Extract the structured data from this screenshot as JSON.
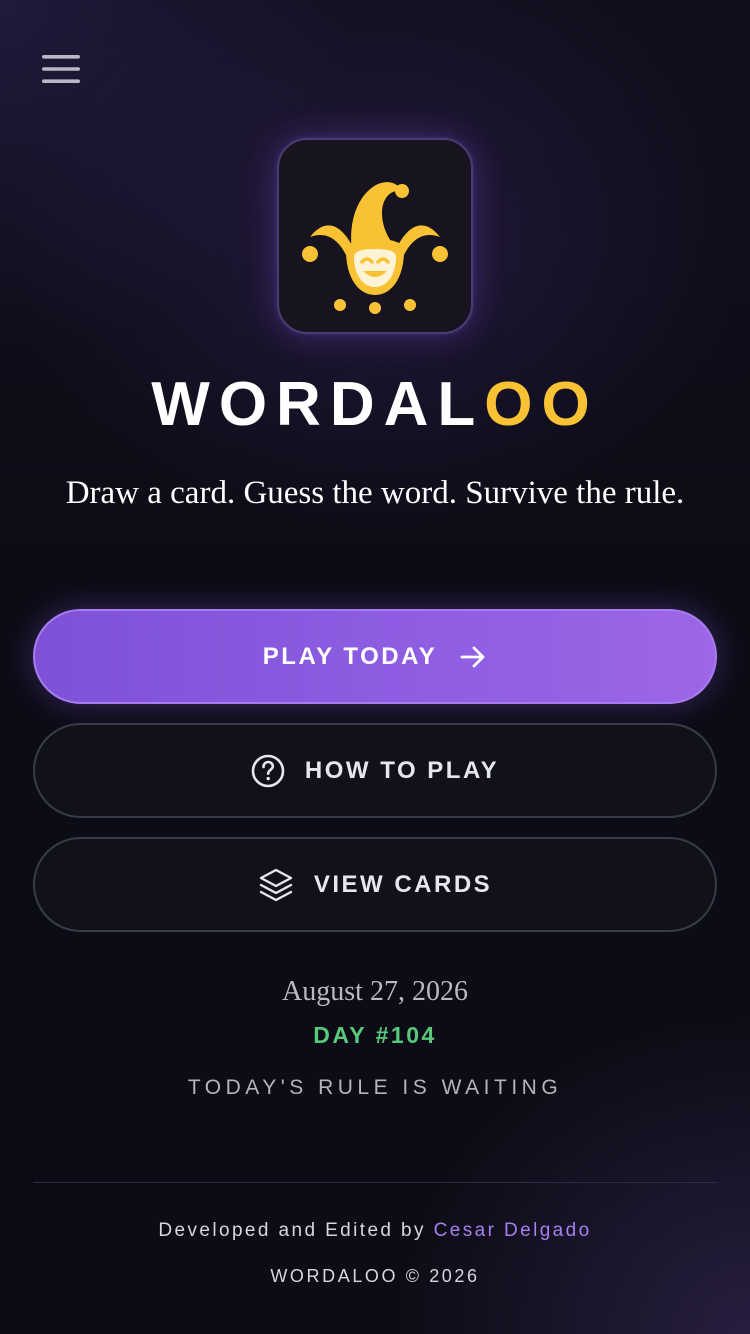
{
  "header": {
    "menu_icon": "hamburger-icon"
  },
  "logo": {
    "icon": "jester-icon",
    "title_main": "WORDAL",
    "title_accent": "OO"
  },
  "tagline": "Draw a card. Guess the word. Survive the rule.",
  "actions": {
    "play": {
      "label": "PLAY TODAY",
      "icon": "arrow-right-icon"
    },
    "how_to_play": {
      "label": "HOW TO PLAY",
      "icon": "question-circle-icon"
    },
    "view_cards": {
      "label": "VIEW CARDS",
      "icon": "layers-icon"
    }
  },
  "daily": {
    "date": "August 27, 2026",
    "day": "DAY #104",
    "status": "TODAY'S RULE IS WAITING"
  },
  "footer": {
    "credit_prefix": "Developed and Edited by",
    "author": "Cesar Delgado",
    "copyright": "WORDALOO © 2026"
  },
  "colors": {
    "accent_purple": "#8e5de2",
    "gold": "#f8c234",
    "day_green": "#57c97a",
    "author_link": "#a77ff0"
  }
}
